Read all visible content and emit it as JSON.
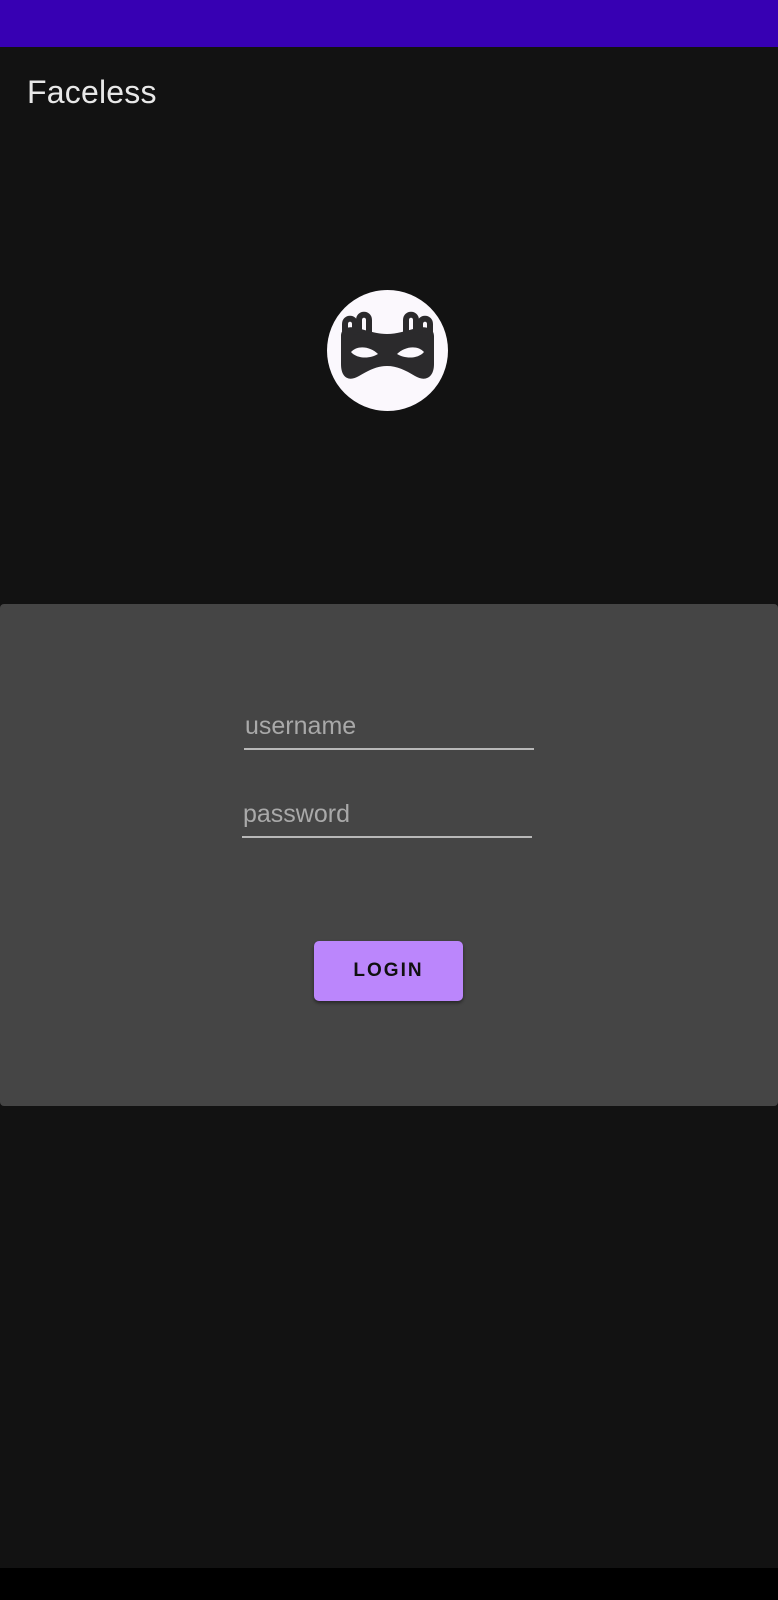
{
  "app": {
    "title": "Faceless"
  },
  "logo": {
    "icon": "mask-icon"
  },
  "login_form": {
    "username": {
      "placeholder": "username",
      "value": ""
    },
    "password": {
      "placeholder": "password",
      "value": ""
    },
    "login_label": "LOGIN"
  },
  "colors": {
    "status_bar": "#3700b3",
    "background": "#121212",
    "card": "#454545",
    "accent": "#bb86fc",
    "logo_bg": "#fbf8fd"
  }
}
